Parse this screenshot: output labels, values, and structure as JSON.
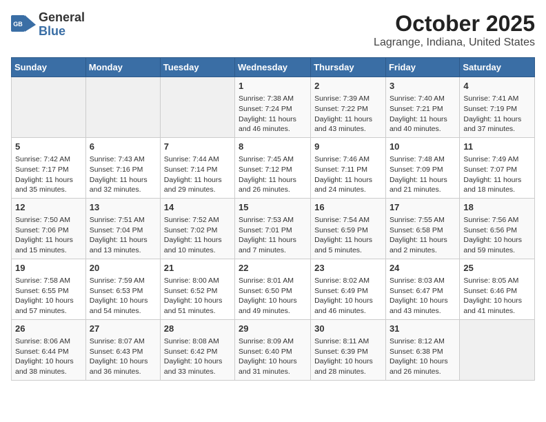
{
  "header": {
    "logo_general": "General",
    "logo_blue": "Blue",
    "title": "October 2025",
    "subtitle": "Lagrange, Indiana, United States"
  },
  "calendar": {
    "days_of_week": [
      "Sunday",
      "Monday",
      "Tuesday",
      "Wednesday",
      "Thursday",
      "Friday",
      "Saturday"
    ],
    "weeks": [
      [
        {
          "day": "",
          "info": ""
        },
        {
          "day": "",
          "info": ""
        },
        {
          "day": "",
          "info": ""
        },
        {
          "day": "1",
          "info": "Sunrise: 7:38 AM\nSunset: 7:24 PM\nDaylight: 11 hours and 46 minutes."
        },
        {
          "day": "2",
          "info": "Sunrise: 7:39 AM\nSunset: 7:22 PM\nDaylight: 11 hours and 43 minutes."
        },
        {
          "day": "3",
          "info": "Sunrise: 7:40 AM\nSunset: 7:21 PM\nDaylight: 11 hours and 40 minutes."
        },
        {
          "day": "4",
          "info": "Sunrise: 7:41 AM\nSunset: 7:19 PM\nDaylight: 11 hours and 37 minutes."
        }
      ],
      [
        {
          "day": "5",
          "info": "Sunrise: 7:42 AM\nSunset: 7:17 PM\nDaylight: 11 hours and 35 minutes."
        },
        {
          "day": "6",
          "info": "Sunrise: 7:43 AM\nSunset: 7:16 PM\nDaylight: 11 hours and 32 minutes."
        },
        {
          "day": "7",
          "info": "Sunrise: 7:44 AM\nSunset: 7:14 PM\nDaylight: 11 hours and 29 minutes."
        },
        {
          "day": "8",
          "info": "Sunrise: 7:45 AM\nSunset: 7:12 PM\nDaylight: 11 hours and 26 minutes."
        },
        {
          "day": "9",
          "info": "Sunrise: 7:46 AM\nSunset: 7:11 PM\nDaylight: 11 hours and 24 minutes."
        },
        {
          "day": "10",
          "info": "Sunrise: 7:48 AM\nSunset: 7:09 PM\nDaylight: 11 hours and 21 minutes."
        },
        {
          "day": "11",
          "info": "Sunrise: 7:49 AM\nSunset: 7:07 PM\nDaylight: 11 hours and 18 minutes."
        }
      ],
      [
        {
          "day": "12",
          "info": "Sunrise: 7:50 AM\nSunset: 7:06 PM\nDaylight: 11 hours and 15 minutes."
        },
        {
          "day": "13",
          "info": "Sunrise: 7:51 AM\nSunset: 7:04 PM\nDaylight: 11 hours and 13 minutes."
        },
        {
          "day": "14",
          "info": "Sunrise: 7:52 AM\nSunset: 7:02 PM\nDaylight: 11 hours and 10 minutes."
        },
        {
          "day": "15",
          "info": "Sunrise: 7:53 AM\nSunset: 7:01 PM\nDaylight: 11 hours and 7 minutes."
        },
        {
          "day": "16",
          "info": "Sunrise: 7:54 AM\nSunset: 6:59 PM\nDaylight: 11 hours and 5 minutes."
        },
        {
          "day": "17",
          "info": "Sunrise: 7:55 AM\nSunset: 6:58 PM\nDaylight: 11 hours and 2 minutes."
        },
        {
          "day": "18",
          "info": "Sunrise: 7:56 AM\nSunset: 6:56 PM\nDaylight: 10 hours and 59 minutes."
        }
      ],
      [
        {
          "day": "19",
          "info": "Sunrise: 7:58 AM\nSunset: 6:55 PM\nDaylight: 10 hours and 57 minutes."
        },
        {
          "day": "20",
          "info": "Sunrise: 7:59 AM\nSunset: 6:53 PM\nDaylight: 10 hours and 54 minutes."
        },
        {
          "day": "21",
          "info": "Sunrise: 8:00 AM\nSunset: 6:52 PM\nDaylight: 10 hours and 51 minutes."
        },
        {
          "day": "22",
          "info": "Sunrise: 8:01 AM\nSunset: 6:50 PM\nDaylight: 10 hours and 49 minutes."
        },
        {
          "day": "23",
          "info": "Sunrise: 8:02 AM\nSunset: 6:49 PM\nDaylight: 10 hours and 46 minutes."
        },
        {
          "day": "24",
          "info": "Sunrise: 8:03 AM\nSunset: 6:47 PM\nDaylight: 10 hours and 43 minutes."
        },
        {
          "day": "25",
          "info": "Sunrise: 8:05 AM\nSunset: 6:46 PM\nDaylight: 10 hours and 41 minutes."
        }
      ],
      [
        {
          "day": "26",
          "info": "Sunrise: 8:06 AM\nSunset: 6:44 PM\nDaylight: 10 hours and 38 minutes."
        },
        {
          "day": "27",
          "info": "Sunrise: 8:07 AM\nSunset: 6:43 PM\nDaylight: 10 hours and 36 minutes."
        },
        {
          "day": "28",
          "info": "Sunrise: 8:08 AM\nSunset: 6:42 PM\nDaylight: 10 hours and 33 minutes."
        },
        {
          "day": "29",
          "info": "Sunrise: 8:09 AM\nSunset: 6:40 PM\nDaylight: 10 hours and 31 minutes."
        },
        {
          "day": "30",
          "info": "Sunrise: 8:11 AM\nSunset: 6:39 PM\nDaylight: 10 hours and 28 minutes."
        },
        {
          "day": "31",
          "info": "Sunrise: 8:12 AM\nSunset: 6:38 PM\nDaylight: 10 hours and 26 minutes."
        },
        {
          "day": "",
          "info": ""
        }
      ]
    ]
  }
}
